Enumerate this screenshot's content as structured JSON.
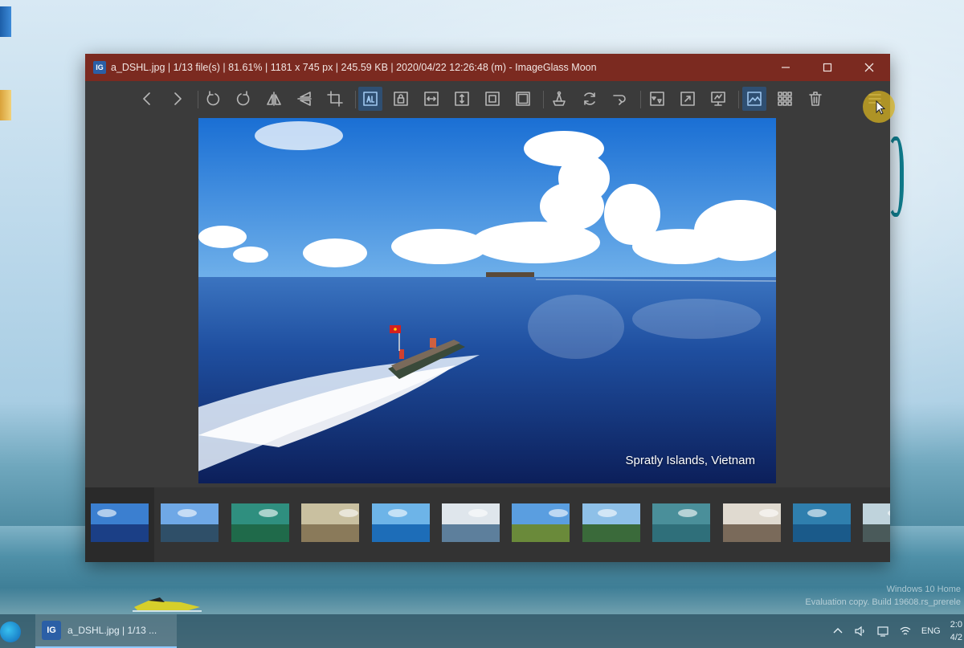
{
  "window": {
    "title": "a_DSHL.jpg  |  1/13 file(s)  |  81.61%  |  1181 x 745 px  |  245.59 KB  |  2020/04/22 12:26:48 (m)  - ImageGlass Moon",
    "logo_text": "IG"
  },
  "toolbar": {
    "buttons": [
      {
        "name": "previous-image-button",
        "icon": "chevron-left-icon"
      },
      {
        "name": "next-image-button",
        "icon": "chevron-right-icon"
      },
      {
        "name": "rotate-left-button",
        "icon": "rotate-left-icon"
      },
      {
        "name": "rotate-right-button",
        "icon": "rotate-right-icon"
      },
      {
        "name": "flip-horizontal-button",
        "icon": "flip-horizontal-icon"
      },
      {
        "name": "flip-vertical-button",
        "icon": "flip-vertical-icon"
      },
      {
        "name": "crop-button",
        "icon": "crop-icon"
      },
      {
        "name": "auto-zoom-button",
        "icon": "auto-zoom-icon",
        "active": true
      },
      {
        "name": "lock-zoom-button",
        "icon": "lock-zoom-icon"
      },
      {
        "name": "scale-to-width-button",
        "icon": "scale-width-icon"
      },
      {
        "name": "scale-to-height-button",
        "icon": "scale-height-icon"
      },
      {
        "name": "scale-to-fit-button",
        "icon": "scale-fit-icon"
      },
      {
        "name": "scale-to-fill-button",
        "icon": "scale-fill-icon"
      },
      {
        "name": "color-picker-button",
        "icon": "color-picker-icon"
      },
      {
        "name": "refresh-button",
        "icon": "refresh-icon"
      },
      {
        "name": "go-to-button",
        "icon": "go-to-icon"
      },
      {
        "name": "slideshow-button",
        "icon": "slideshow-icon"
      },
      {
        "name": "fullscreen-button",
        "icon": "fullscreen-icon"
      },
      {
        "name": "frameless-button",
        "icon": "frameless-icon"
      },
      {
        "name": "thumbnail-bar-button",
        "icon": "thumbnail-bar-icon",
        "active": true
      },
      {
        "name": "checkerboard-button",
        "icon": "grid-icon"
      },
      {
        "name": "delete-button",
        "icon": "trash-icon"
      }
    ]
  },
  "viewer": {
    "caption": "Spratly Islands, Vietnam"
  },
  "thumbnails": [
    {
      "name": "thumb-1",
      "sky": "#3b7fd0",
      "ground": "#1b3f86"
    },
    {
      "name": "thumb-2",
      "sky": "#6fa8e6",
      "ground": "#2f4f68"
    },
    {
      "name": "thumb-3",
      "sky": "#2f8f7f",
      "ground": "#1f6a4a"
    },
    {
      "name": "thumb-4",
      "sky": "#c9c0a0",
      "ground": "#8a7a5a"
    },
    {
      "name": "thumb-5",
      "sky": "#6db4e8",
      "ground": "#1d6db8"
    },
    {
      "name": "thumb-6",
      "sky": "#dfe6ec",
      "ground": "#5d7f9c"
    },
    {
      "name": "thumb-7",
      "sky": "#5a9ee0",
      "ground": "#6a8a3a"
    },
    {
      "name": "thumb-8",
      "sky": "#8ec0e8",
      "ground": "#3a6a3a"
    },
    {
      "name": "thumb-9",
      "sky": "#4a8f9a",
      "ground": "#2f6f7a"
    },
    {
      "name": "thumb-10",
      "sky": "#e0dad0",
      "ground": "#7a6a5a"
    },
    {
      "name": "thumb-11",
      "sky": "#2f7fae",
      "ground": "#1a5a8a"
    },
    {
      "name": "thumb-12",
      "sky": "#bfd3dc",
      "ground": "#4a5a5a"
    }
  ],
  "taskbar": {
    "app_icon_text": "IG",
    "task_label": "a_DSHL.jpg  |  1/13 ...",
    "language": "ENG",
    "time": "2:0",
    "date": "4/2"
  },
  "desktop": {
    "watermark_line1": "Windows 10 Home",
    "watermark_line2": "Evaluation copy. Build 19608.rs_prerele"
  },
  "colors": {
    "titlebar": "#7b2a20",
    "window_bg": "#3b3b3b",
    "active_tool": "#2f4f72"
  }
}
